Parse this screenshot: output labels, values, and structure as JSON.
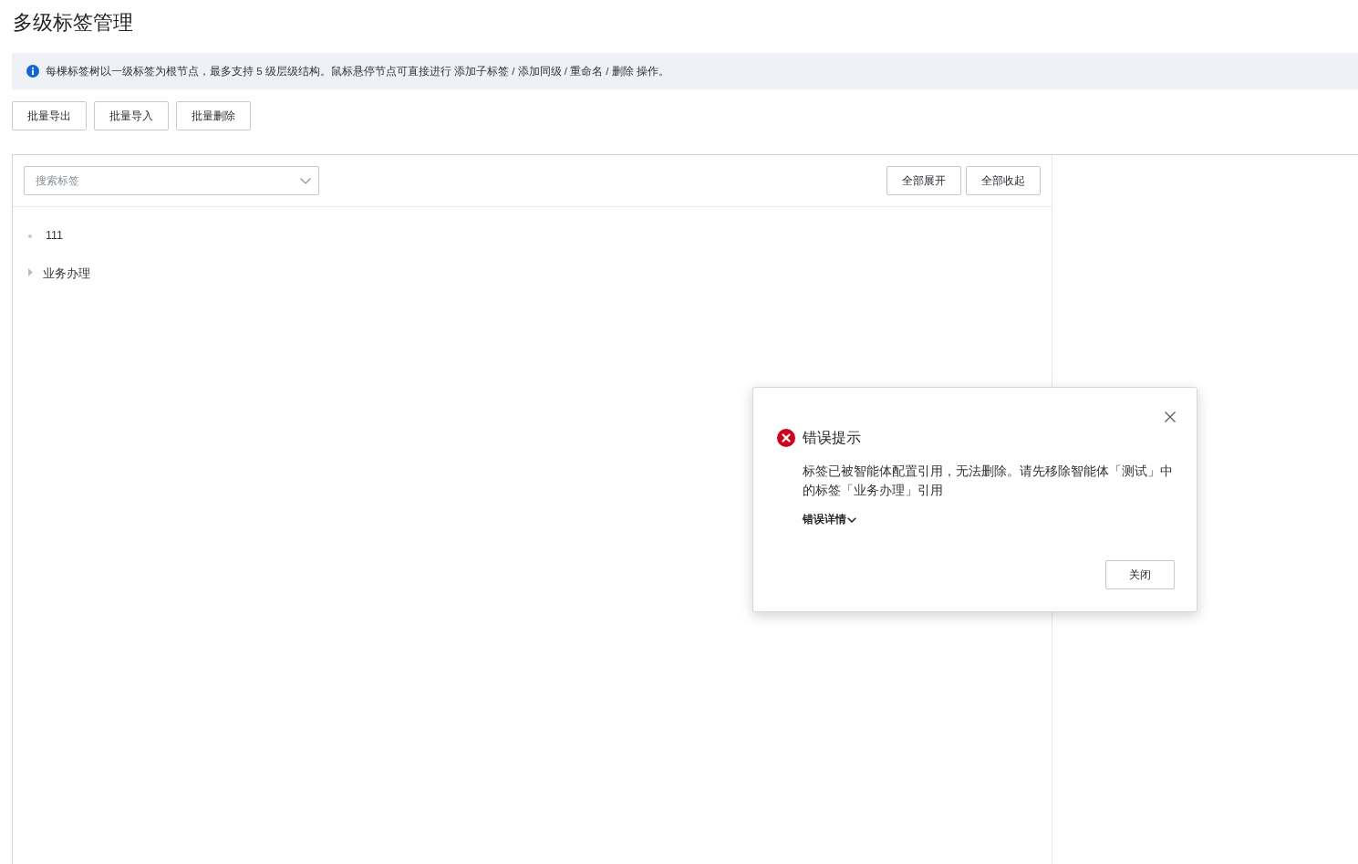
{
  "page": {
    "title": "多级标签管理"
  },
  "notice": {
    "kind": "info",
    "text": "每棵标签树以一级标签为根节点，最多支持 5 级层级结构。鼠标悬停节点可直接进行 添加子标签 / 添加同级 / 重命名 / 删除 操作。"
  },
  "toolbar": [
    "批量导出",
    "批量导入",
    "批量删除"
  ],
  "tree_panel": {
    "search": {
      "placeholder": "搜索标签"
    },
    "actions": [
      "全部展开",
      "全部收起"
    ],
    "nodes": [
      {
        "label": "111",
        "kind": "leaf"
      },
      {
        "label": "业务办理",
        "kind": "collapsed"
      }
    ]
  },
  "dialog": {
    "kind": "error",
    "title": "错误提示",
    "message": "标签已被智能体配置引用，无法删除。请先移除智能体「测试」中的标签「业务办理」引用",
    "details": {
      "label": "错误详情",
      "expanded": false
    },
    "buttons": [
      "关闭"
    ]
  }
}
